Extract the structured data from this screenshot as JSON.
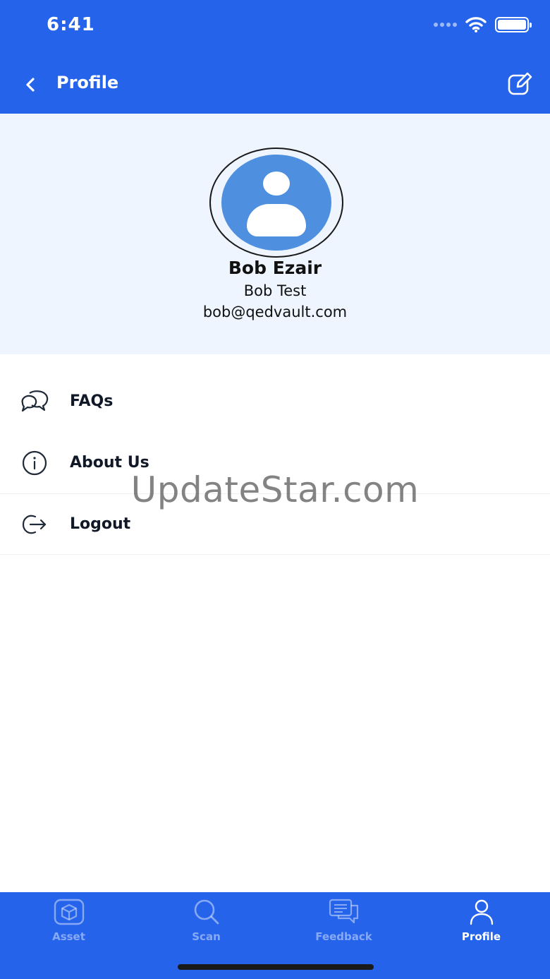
{
  "status": {
    "time": "6:41"
  },
  "header": {
    "title": "Profile"
  },
  "profile": {
    "name": "Bob Ezair",
    "organization": "Bob Test",
    "email": "bob@qedvault.com"
  },
  "menu": {
    "faqs": "FAQs",
    "about": "About Us",
    "logout": "Logout"
  },
  "watermark": "UpdateStar.com",
  "tabs": {
    "asset": "Asset",
    "scan": "Scan",
    "feedback": "Feedback",
    "profile": "Profile"
  },
  "active_tab": "Profile",
  "colors": {
    "primary": "#2563eb",
    "card": "#eef5ff",
    "avatar": "#4e8fe0"
  }
}
